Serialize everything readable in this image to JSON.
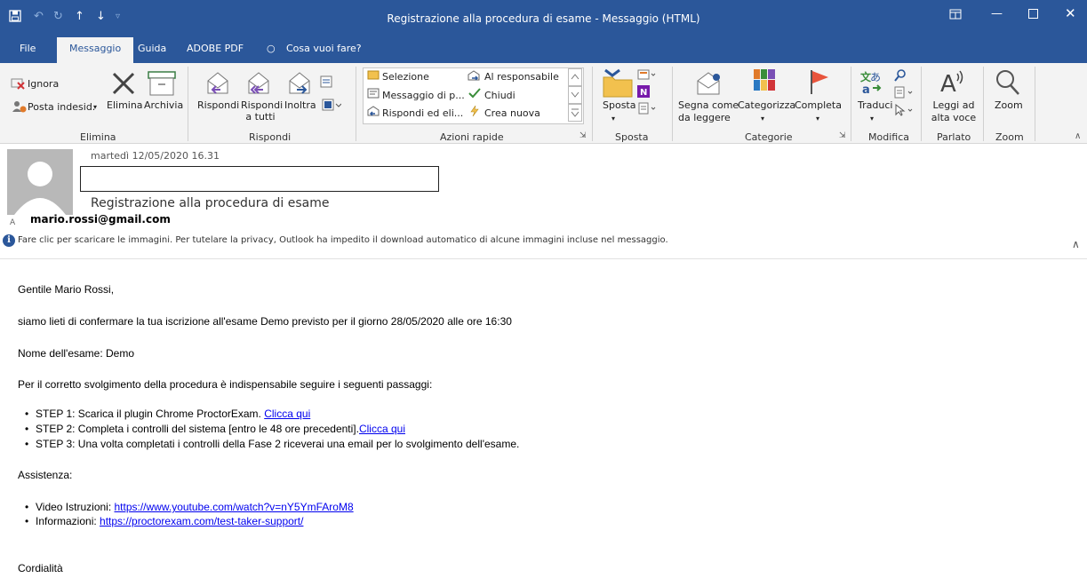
{
  "window": {
    "title": "Registrazione alla procedura di esame  -  Messaggio (HTML)"
  },
  "tabs": [
    "File",
    "Messaggio",
    "Guida",
    "ADOBE PDF",
    "Cosa vuoi fare?"
  ],
  "ribbon": {
    "elimina": {
      "group_label": "Elimina",
      "ignora": "Ignora",
      "posta_indesiderata": "Posta indesid.",
      "elimina": "Elimina",
      "archivia": "Archivia"
    },
    "rispondi": {
      "group_label": "Rispondi",
      "rispondi": "Rispondi",
      "rispondi_tutti_1": "Rispondi",
      "rispondi_tutti_2": "a tutti",
      "inoltra": "Inoltra"
    },
    "azioni_rapide": {
      "group_label": "Azioni rapide",
      "items": [
        "Selezione",
        "Messaggio di p...",
        "Rispondi ed eli...",
        "Al responsabile",
        "Chiudi",
        "Crea nuova"
      ]
    },
    "sposta": {
      "group_label": "Sposta",
      "sposta": "Sposta"
    },
    "categorie": {
      "group_label": "Categorie",
      "segna_1": "Segna come",
      "segna_2": "da leggere",
      "categorizza": "Categorizza",
      "completa": "Completa"
    },
    "modifica": {
      "group_label": "Modifica",
      "traduci": "Traduci"
    },
    "parlato": {
      "group_label": "Parlato",
      "leggi_1": "Leggi ad",
      "leggi_2": "alta voce"
    },
    "zoom": {
      "group_label": "Zoom",
      "zoom": "Zoom"
    }
  },
  "message": {
    "date": "martedì 12/05/2020 16.31",
    "to_label": "A",
    "subject": "Registrazione alla procedura di esame",
    "sender": "mario.rossi@gmail.com",
    "infobar": "Fare clic per scaricare le immagini. Per tutelare la privacy, Outlook ha impedito il download automatico di alcune immagini incluse nel messaggio."
  },
  "body": {
    "greeting": "Gentile Mario Rossi,",
    "intro": "siamo lieti di confermare la tua iscrizione all'esame Demo previsto per il giorno 28/05/2020 alle ore 16:30",
    "exam_name": "Nome dell'esame: Demo",
    "steps_intro": "Per il corretto svolgimento della procedura è indispensabile seguire i seguenti passaggi:",
    "step1_text": "STEP 1: Scarica il plugin Chrome ProctorExam. ",
    "step1_link": "Clicca qui",
    "step2_text": "STEP 2: Completa i controlli del sistema [entro le 48 ore precedenti].",
    "step2_link": "Clicca qui",
    "step3_text": "STEP 3: Una volta completati i controlli della Fase 2 riceverai una email per lo svolgimento dell'esame.",
    "assistenza": "Assistenza:",
    "video_label": "Video Istruzioni: ",
    "video_link": "https://www.youtube.com/watch?v=nY5YmFAroM8",
    "info_label": "Informazioni: ",
    "info_link": "https://proctorexam.com/test-taker-support/",
    "closing": "Cordialità"
  }
}
